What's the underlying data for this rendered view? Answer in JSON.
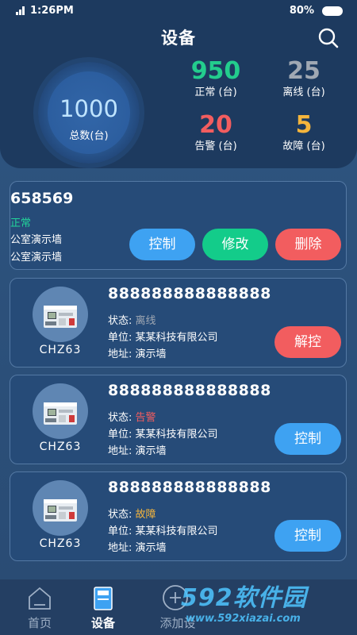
{
  "status_bar": {
    "time": "1:26PM",
    "battery": "80%"
  },
  "header": {
    "title": "设备"
  },
  "summary": {
    "total": {
      "value": "1000",
      "label": "总数(台)"
    },
    "normal": {
      "value": "950",
      "label": "正常 (台)",
      "color": "#23cd8d"
    },
    "offline": {
      "value": "25",
      "label": "离线 (台)",
      "color": "#a0a8b3"
    },
    "alarm": {
      "value": "20",
      "label": "告警 (台)",
      "color": "#f25d5f"
    },
    "fault": {
      "value": "5",
      "label": "故障 (台)",
      "color": "#f5b53c"
    }
  },
  "card1": {
    "id": "658569",
    "status": "正常",
    "line1": "公室演示墙",
    "line2": "公室演示墙",
    "control_label": "控制",
    "edit_label": "修改",
    "delete_label": "删除"
  },
  "devices": [
    {
      "model": "CHZ63",
      "id": "888888888888888",
      "status_prefix": "状态:",
      "status": "离线",
      "status_color": "#a0a8b3",
      "unit": "单位: 某某科技有限公司",
      "address": "地址: 演示墙",
      "action_label": "解控"
    },
    {
      "model": "CHZ63",
      "id": "888888888888888",
      "status_prefix": "状态:",
      "status": "告警",
      "status_color": "#f25d5f",
      "unit": "单位: 某某科技有限公司",
      "address": "地址: 演示墙",
      "action_label": "控制"
    },
    {
      "model": "CHZ63",
      "id": "888888888888888",
      "status_prefix": "状态:",
      "status": "故障",
      "status_color": "#f5b53c",
      "unit": "单位: 某某科技有限公司",
      "address": "地址: 演示墙",
      "action_label": "控制"
    }
  ],
  "nav": {
    "home": "首页",
    "devices": "设备",
    "add": "添加设"
  },
  "watermark": {
    "brand": "592软件园",
    "url": "www.592xiazai.com"
  }
}
